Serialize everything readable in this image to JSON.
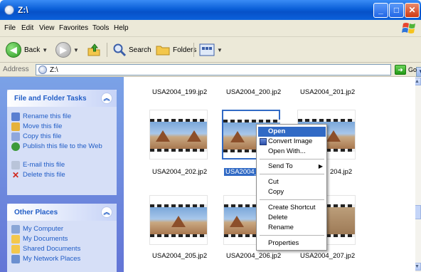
{
  "window": {
    "title": "Z:\\"
  },
  "menu": [
    "File",
    "Edit",
    "View",
    "Favorites",
    "Tools",
    "Help"
  ],
  "toolbar": {
    "back": "Back",
    "search": "Search",
    "folders": "Folders"
  },
  "address": {
    "label": "Address",
    "value": "Z:\\",
    "go": "Go"
  },
  "tasks_panel": {
    "title": "File and Folder Tasks",
    "items": [
      "Rename this file",
      "Move this file",
      "Copy this file",
      "Publish this file to the Web",
      "E-mail this file",
      "Delete this file"
    ]
  },
  "places_panel": {
    "title": "Other Places",
    "items": [
      "My Computer",
      "My Documents",
      "Shared Documents",
      "My Network Places"
    ]
  },
  "files": {
    "row1": [
      "USA2004_199.jp2",
      "USA2004_200.jp2",
      "USA2004_201.jp2"
    ],
    "row2": [
      "USA2004_202.jp2",
      "USA2004_",
      "204.jp2"
    ],
    "row3": [
      "USA2004_205.jp2",
      "USA2004_206.jp2",
      "USA2004_207.jp2"
    ]
  },
  "context_menu": {
    "open": "Open",
    "convert": "Convert Image",
    "open_with": "Open With...",
    "send_to": "Send To",
    "cut": "Cut",
    "copy": "Copy",
    "create_shortcut": "Create Shortcut",
    "delete": "Delete",
    "rename": "Rename",
    "properties": "Properties"
  },
  "colors": {
    "title_blue": "#0a5fd8",
    "selection": "#316ac5",
    "task_link": "#215dc6",
    "pane_bg": "#6f8ddf"
  }
}
